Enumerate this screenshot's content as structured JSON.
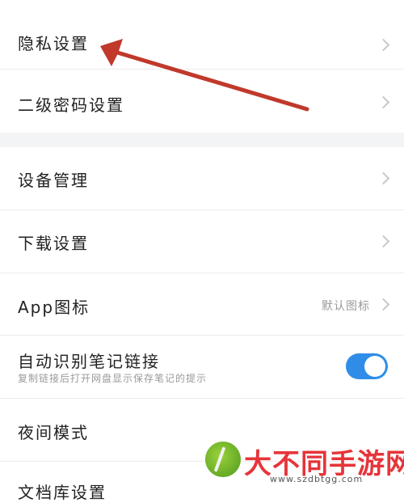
{
  "settings": {
    "privacy": "隐私设置",
    "secondary_password": "二级密码设置",
    "device_management": "设备管理",
    "download_settings": "下载设置",
    "app_icon": "App图标",
    "app_icon_value": "默认图标",
    "auto_detect": "自动识别笔记链接",
    "auto_detect_desc": "复制链接后打开网盘显示保存笔记的提示",
    "auto_detect_enabled": true,
    "night_mode": "夜间模式",
    "partial_bottom": "文档库设置"
  },
  "watermark": {
    "title": "大不同手游网",
    "url": "www.szdbtgg.com"
  },
  "colors": {
    "toggle_on": "#2f8de8",
    "arrow": "#c0392b",
    "watermark_red": "#e6343a"
  },
  "icons": [
    "chevron-right-icon",
    "annotation-arrow",
    "watermark-leaf-icon"
  ]
}
